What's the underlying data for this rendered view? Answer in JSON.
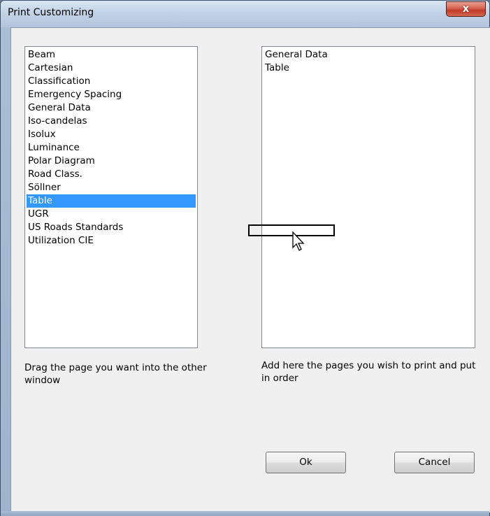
{
  "window": {
    "title": "Print Customizing",
    "close_label": "x"
  },
  "available_list": {
    "items": [
      "Beam",
      "Cartesian",
      "Classification",
      "Emergency Spacing",
      "General Data",
      "Iso-candelas",
      "Isolux",
      "Luminance",
      "Polar Diagram",
      "Road Class.",
      "Söllner",
      "Table",
      "UGR",
      "US Roads Standards",
      "Utilization CIE"
    ],
    "selected": "Table",
    "help_text": "Drag the page you want into the other window"
  },
  "print_list": {
    "items": [
      "General Data",
      "Table"
    ],
    "help_text": "Add here the pages you wish to print and put in order"
  },
  "buttons": {
    "ok_label": "Ok",
    "cancel_label": "Cancel"
  },
  "colors": {
    "selection": "#3399ff",
    "close_button": "#c43a2a",
    "dialog_background": "#f0f0f0"
  }
}
